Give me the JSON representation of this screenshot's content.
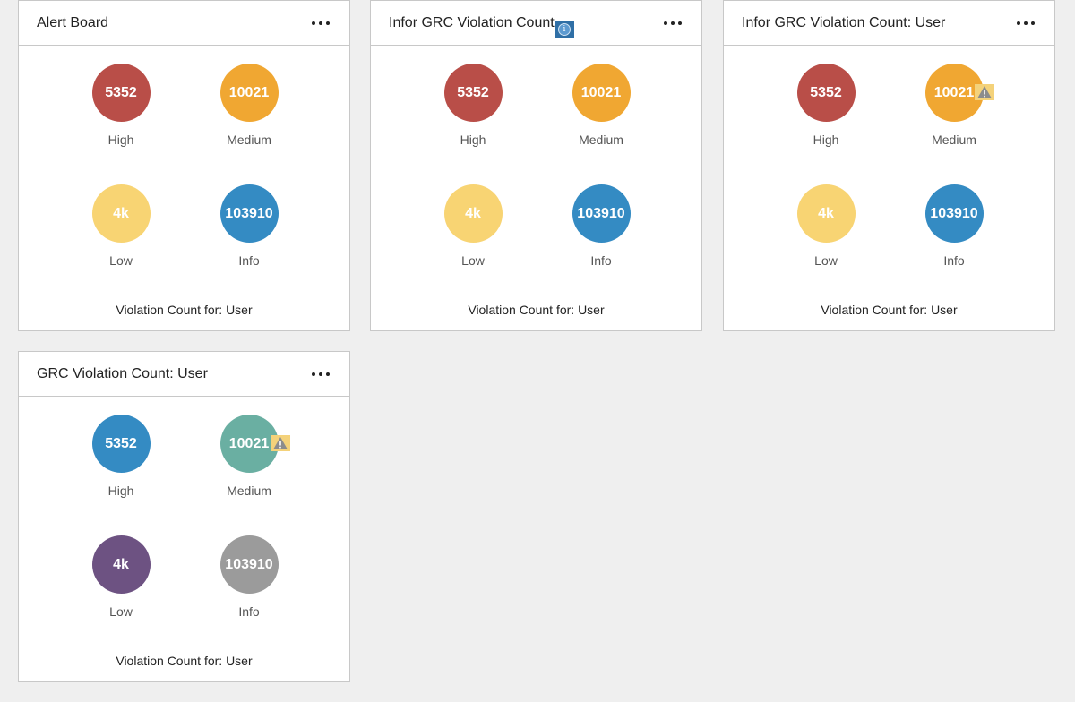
{
  "cards": [
    {
      "title": "Alert Board",
      "footer": "Violation Count for: User",
      "metrics": [
        {
          "value": "5352",
          "label": "High",
          "color": "#b94e48"
        },
        {
          "value": "10021",
          "label": "Medium",
          "color": "#f0a732"
        },
        {
          "value": "4k",
          "label": "Low",
          "color": "#f8d473"
        },
        {
          "value": "103910",
          "label": "Info",
          "color": "#348bc3"
        }
      ]
    },
    {
      "title": "Infor GRC Violation Count",
      "title_icon": "info-icon",
      "footer": "Violation Count for: User",
      "metrics": [
        {
          "value": "5352",
          "label": "High",
          "color": "#b94e48"
        },
        {
          "value": "10021",
          "label": "Medium",
          "color": "#f0a732"
        },
        {
          "value": "4k",
          "label": "Low",
          "color": "#f8d473"
        },
        {
          "value": "103910",
          "label": "Info",
          "color": "#348bc3"
        }
      ]
    },
    {
      "title": "Infor GRC Violation Count: User",
      "footer": "Violation Count for: User",
      "metrics": [
        {
          "value": "5352",
          "label": "High",
          "color": "#b94e48"
        },
        {
          "value": "10021",
          "label": "Medium",
          "color": "#f0a732",
          "icon": "warning-icon"
        },
        {
          "value": "4k",
          "label": "Low",
          "color": "#f8d473"
        },
        {
          "value": "103910",
          "label": "Info",
          "color": "#348bc3"
        }
      ]
    },
    {
      "title": "GRC Violation Count: User",
      "footer": "Violation Count for: User",
      "metrics": [
        {
          "value": "5352",
          "label": "High",
          "color": "#348bc3"
        },
        {
          "value": "10021",
          "label": "Medium",
          "color": "#6aafa2",
          "icon": "warning-icon"
        },
        {
          "value": "4k",
          "label": "Low",
          "color": "#6d5282"
        },
        {
          "value": "103910",
          "label": "Info",
          "color": "#9b9b9b"
        }
      ]
    }
  ]
}
